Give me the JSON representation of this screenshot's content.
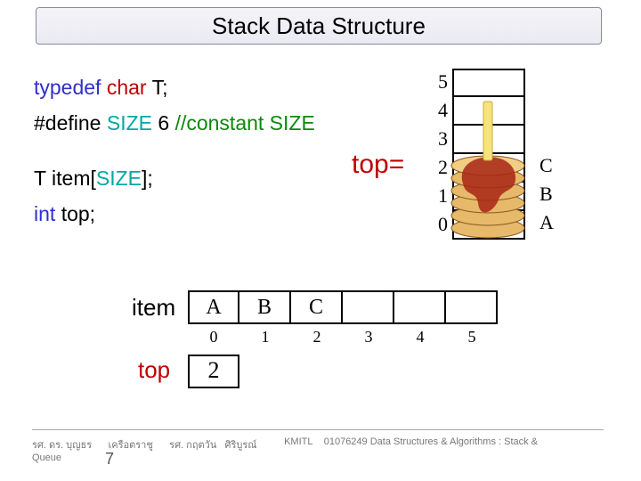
{
  "title": "Stack Data Structure",
  "code": {
    "l1_a": "typedef ",
    "l1_b": "char ",
    "l1_c": "T;",
    "l2_a": "#define ",
    "l2_b": "SIZE ",
    "l2_c": "6  ",
    "l2_d": "//constant SIZE",
    "l3_a": "T  item[",
    "l3_b": "SIZE",
    "l3_c": "];",
    "l4_a": "int ",
    "l4_b": "top;"
  },
  "top_marker": "top=",
  "stack": {
    "indices": [
      "5",
      "4",
      "3",
      "2",
      "1",
      "0"
    ],
    "values": [
      "",
      "",
      "",
      "C",
      "B",
      "A"
    ]
  },
  "array": {
    "label": "item",
    "cells": [
      "A",
      "B",
      "C",
      "",
      "",
      ""
    ],
    "indices": [
      "0",
      "1",
      "2",
      "3",
      "4",
      "5"
    ]
  },
  "top_box": {
    "label": "top",
    "value": "2"
  },
  "footer": {
    "left1": "รศ. ดร. บุญธร",
    "left2": "เครือตราชู",
    "left3": "รศ. กฤตวัน",
    "left4": "ศิริบูรณ์",
    "center": "KMITL",
    "right": "01076249 Data Structures & Algorithms : Stack &",
    "line2": "Queue",
    "slide": "7"
  },
  "chart_data": {
    "type": "table",
    "title": "Stack Data Structure",
    "stack_size": 6,
    "top_index": 2,
    "item_array": [
      {
        "index": 0,
        "value": "A"
      },
      {
        "index": 1,
        "value": "B"
      },
      {
        "index": 2,
        "value": "C"
      },
      {
        "index": 3,
        "value": ""
      },
      {
        "index": 4,
        "value": ""
      },
      {
        "index": 5,
        "value": ""
      }
    ],
    "visual_stack_top_to_bottom": [
      {
        "slot": 5,
        "value": ""
      },
      {
        "slot": 4,
        "value": ""
      },
      {
        "slot": 3,
        "value": ""
      },
      {
        "slot": 2,
        "value": "C"
      },
      {
        "slot": 1,
        "value": "B"
      },
      {
        "slot": 0,
        "value": "A"
      }
    ]
  }
}
